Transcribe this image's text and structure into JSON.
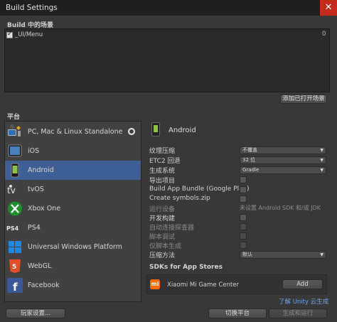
{
  "window": {
    "title": "Build Settings",
    "close_glyph": "✕"
  },
  "scenes": {
    "label": "Build 中的场景",
    "items": [
      {
        "name": "_UI/Menu",
        "index": "0",
        "checked": true
      }
    ],
    "add_open_button": "添加已打开场景"
  },
  "platforms": {
    "label": "平台",
    "items": [
      {
        "label": "PC, Mac & Linux Standalone",
        "icon": "monitor-icon"
      },
      {
        "label": "iOS",
        "icon": "ipad-icon"
      },
      {
        "label": "Android",
        "icon": "android-phone-icon",
        "selected": true
      },
      {
        "label": "tvOS",
        "icon": "appletv-icon"
      },
      {
        "label": "Xbox One",
        "icon": "xbox-icon"
      },
      {
        "label": "PS4",
        "icon": "ps4-icon"
      },
      {
        "label": "Universal Windows Platform",
        "icon": "windows-icon"
      },
      {
        "label": "WebGL",
        "icon": "html5-icon"
      },
      {
        "label": "Facebook",
        "icon": "facebook-icon"
      }
    ]
  },
  "android": {
    "title": "Android",
    "settings": {
      "texture_compression": {
        "label": "纹理压缩",
        "value": "不覆盖"
      },
      "etc2_fallback": {
        "label": "ETC2 回退",
        "value": "32 位"
      },
      "build_system": {
        "label": "生成系统",
        "value": "Gradle"
      },
      "export_project": {
        "label": "导出项目"
      },
      "build_app_bundle": {
        "label": "Build App Bundle (Google Play)"
      },
      "create_symbols": {
        "label": "Create symbols.zip"
      },
      "run_device": {
        "label": "运行设备",
        "warning": "未设置 Android SDK 和/或 JDK"
      },
      "development_build": {
        "label": "开发构建"
      },
      "autoconnect_profiler": {
        "label": "自动连接探查器"
      },
      "script_debugging": {
        "label": "脚本调试"
      },
      "scripts_only_build": {
        "label": "仅脚本生成"
      },
      "compression_method": {
        "label": "压缩方法",
        "value": "默认"
      }
    },
    "sdks": {
      "title": "SDKs for App Stores",
      "items": [
        {
          "name": "Xiaomi Mi Game Center",
          "icon_text": "mi",
          "button": "Add"
        }
      ],
      "learn_link": "了解 Unity 云生成"
    }
  },
  "footer": {
    "player_settings": "玩家设置...",
    "switch_platform": "切换平台",
    "build_and_run": "生成和运行"
  },
  "colors": {
    "accent": "#3e5f96",
    "close_red": "#c42b1c",
    "link": "#6fa3ef"
  }
}
